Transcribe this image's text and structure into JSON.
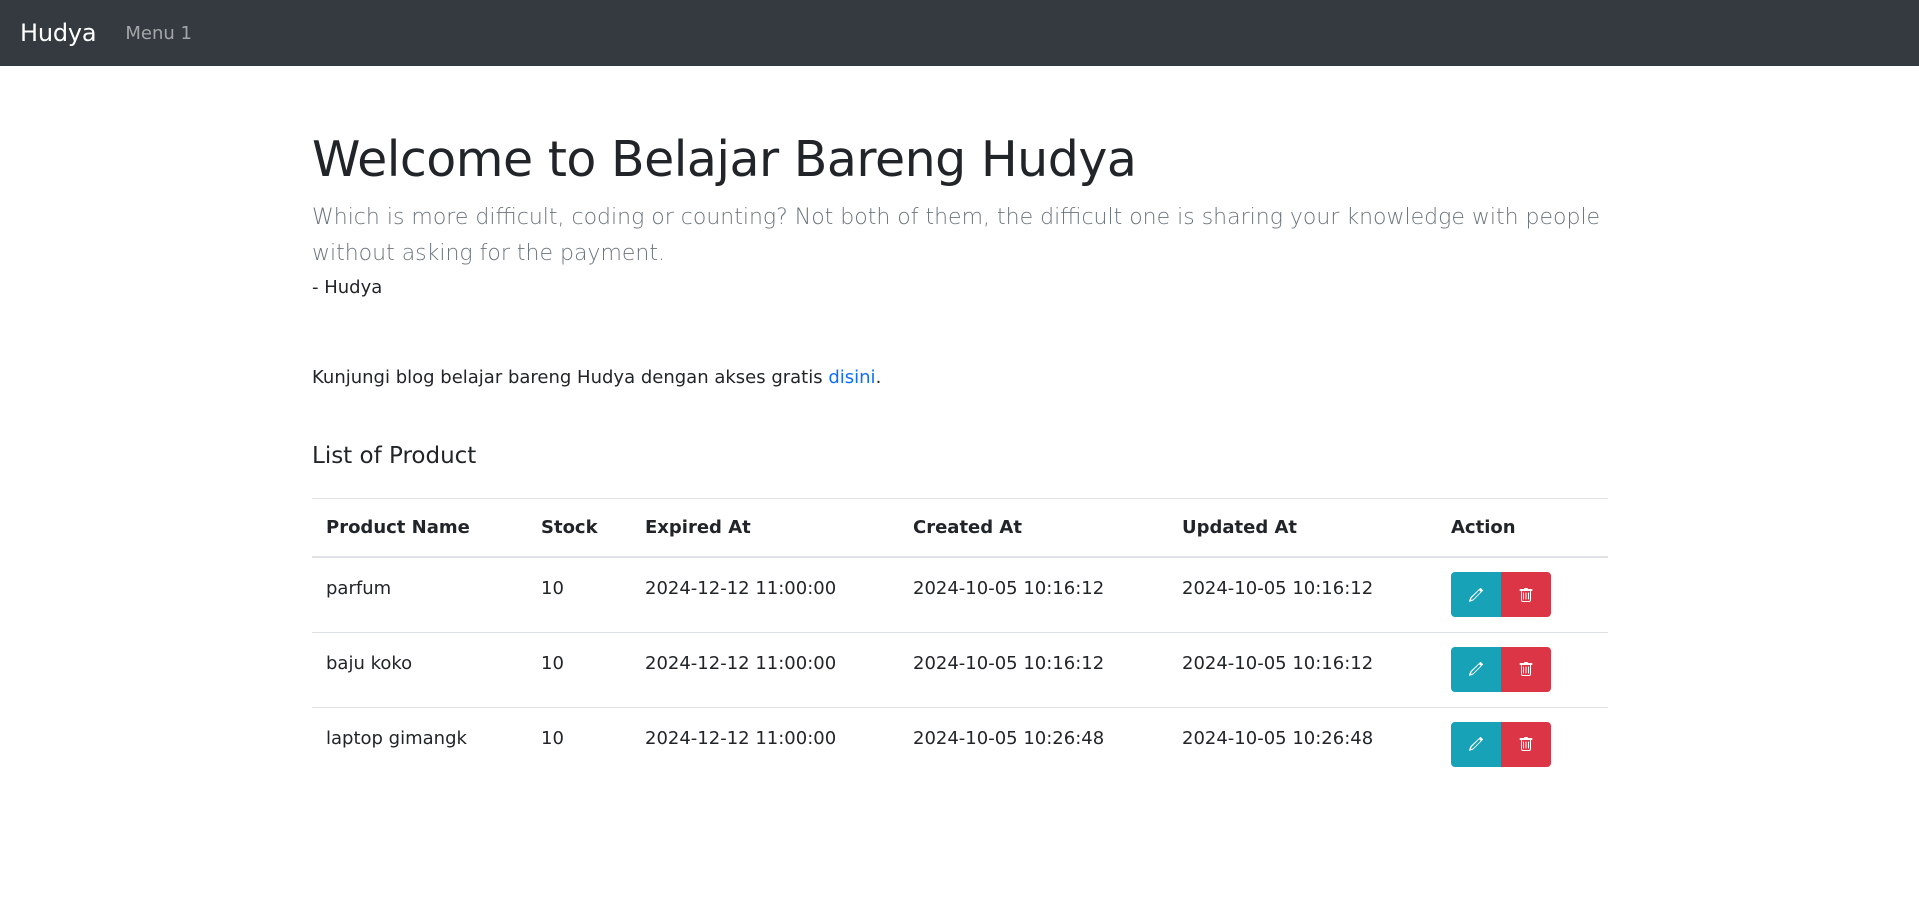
{
  "navbar": {
    "brand": "Hudya",
    "menu_1": "Menu 1"
  },
  "hero": {
    "title": "Welcome to Belajar Bareng Hudya",
    "lead": "Which is more difficult, coding or counting? Not both of them, the difficult one is sharing your knowledge with people without asking for the payment.",
    "author": "- Hudya"
  },
  "blog": {
    "text": "Kunjungi blog belajar bareng Hudya dengan akses gratis ",
    "link": "disini",
    "suffix": "."
  },
  "products": {
    "title": "List of Product",
    "headers": [
      "Product Name",
      "Stock",
      "Expired At",
      "Created At",
      "Updated At",
      "Action"
    ],
    "rows": [
      {
        "name": "parfum",
        "stock": "10",
        "expired_at": "2024-12-12 11:00:00",
        "created_at": "2024-10-05 10:16:12",
        "updated_at": "2024-10-05 10:16:12"
      },
      {
        "name": "baju koko",
        "stock": "10",
        "expired_at": "2024-12-12 11:00:00",
        "created_at": "2024-10-05 10:16:12",
        "updated_at": "2024-10-05 10:16:12"
      },
      {
        "name": "laptop gimangk",
        "stock": "10",
        "expired_at": "2024-12-12 11:00:00",
        "created_at": "2024-10-05 10:26:48",
        "updated_at": "2024-10-05 10:26:48"
      }
    ]
  },
  "icons": {
    "edit": "pencil-icon",
    "delete": "trash-icon"
  },
  "colors": {
    "navbar": "#343a40",
    "link": "#0d6efd",
    "edit_button": "#17a2b8",
    "delete_button": "#dc3545"
  }
}
